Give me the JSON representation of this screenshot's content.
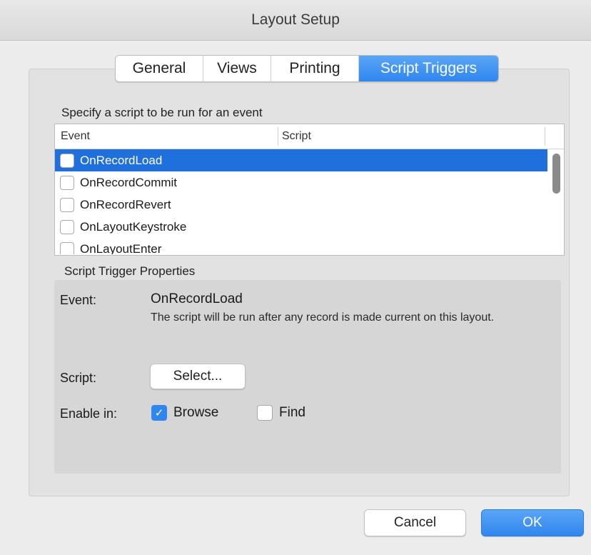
{
  "window": {
    "title": "Layout Setup"
  },
  "tabs": [
    {
      "label": "General",
      "active": false
    },
    {
      "label": "Views",
      "active": false
    },
    {
      "label": "Printing",
      "active": false
    },
    {
      "label": "Script Triggers",
      "active": true
    }
  ],
  "event_list": {
    "heading": "Specify a script to be run for an event",
    "columns": {
      "event": "Event",
      "script": "Script"
    },
    "rows": [
      {
        "event": "OnRecordLoad",
        "script": "",
        "checked": false,
        "selected": true
      },
      {
        "event": "OnRecordCommit",
        "script": "",
        "checked": false,
        "selected": false
      },
      {
        "event": "OnRecordRevert",
        "script": "",
        "checked": false,
        "selected": false
      },
      {
        "event": "OnLayoutKeystroke",
        "script": "",
        "checked": false,
        "selected": false
      },
      {
        "event": "OnLayoutEnter",
        "script": "",
        "checked": false,
        "selected": false
      }
    ]
  },
  "properties": {
    "heading": "Script Trigger Properties",
    "event_label": "Event:",
    "event_value": "OnRecordLoad",
    "description": "The script will be run after any record is made current on this layout.",
    "script_label": "Script:",
    "select_button": "Select...",
    "enable_label": "Enable in:",
    "browse": {
      "label": "Browse",
      "checked": true
    },
    "find": {
      "label": "Find",
      "checked": false
    }
  },
  "footer": {
    "cancel": "Cancel",
    "ok": "OK"
  },
  "colors": {
    "accent": "#2f86ee",
    "selection": "#1f6fdc"
  },
  "icons": {
    "check": "✓"
  }
}
